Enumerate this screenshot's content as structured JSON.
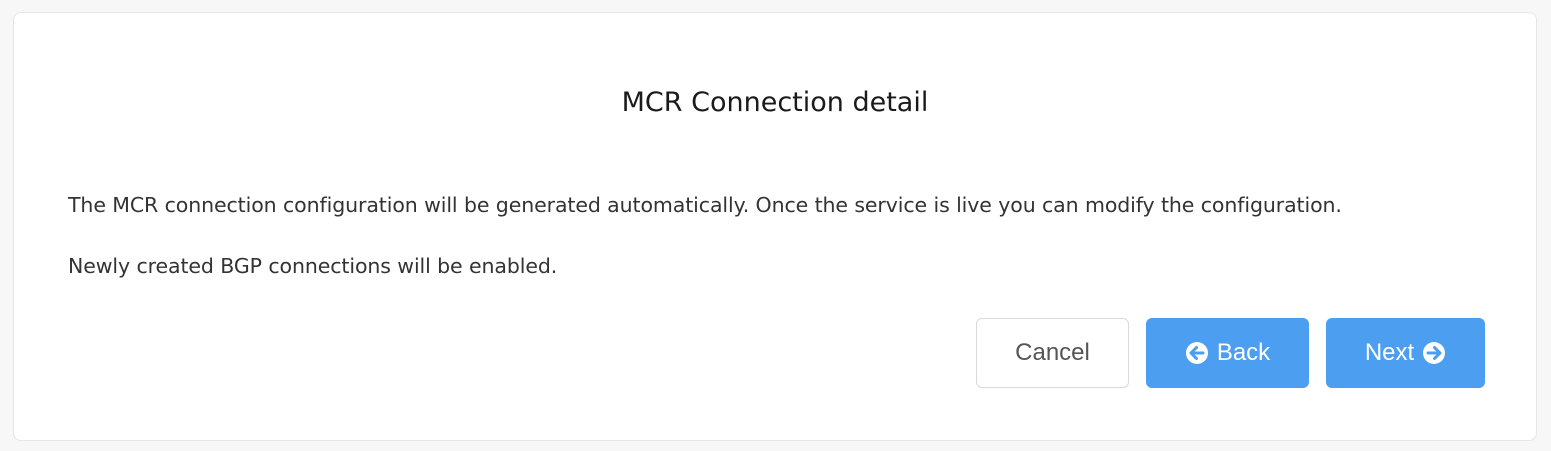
{
  "dialog": {
    "title": "MCR Connection detail",
    "paragraphs": [
      "The MCR connection configuration will be generated automatically. Once the service is live you can modify the configuration.",
      "Newly created BGP connections will be enabled."
    ]
  },
  "buttons": {
    "cancel": "Cancel",
    "back": "Back",
    "next": "Next"
  },
  "icons": {
    "back": "arrow-circle-left-icon",
    "next": "arrow-circle-right-icon"
  },
  "colors": {
    "primary": "#4c9ef0",
    "background": "#f7f7f7",
    "card": "#ffffff",
    "text": "#333333"
  }
}
